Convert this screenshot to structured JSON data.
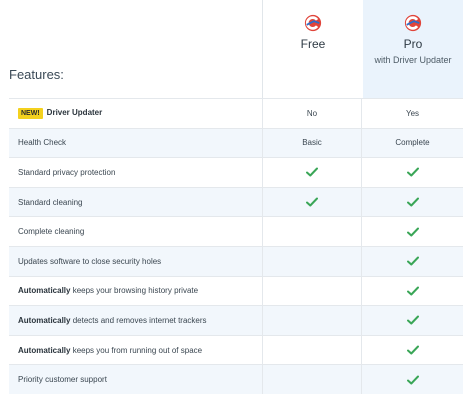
{
  "header": {
    "features_title": "Features:",
    "plans": [
      {
        "name": "Free",
        "subtitle": ""
      },
      {
        "name": "Pro",
        "subtitle": "with Driver Updater"
      }
    ],
    "logo_icon": "ccleaner-logo-icon"
  },
  "colors": {
    "check": "#3aa657",
    "badge": "#f4d11e",
    "pro_column_bg": "#eaf3fc",
    "alt_row_bg": "#f2f7fc"
  },
  "rows": [
    {
      "badge": "NEW!",
      "bold": "Driver Updater",
      "text": "",
      "free": "No",
      "pro": "Yes",
      "free_check": false,
      "pro_check": false,
      "alt": false
    },
    {
      "badge": "",
      "bold": "",
      "text": "Health Check",
      "free": "Basic",
      "pro": "Complete",
      "free_check": false,
      "pro_check": false,
      "alt": true
    },
    {
      "badge": "",
      "bold": "",
      "text": "Standard privacy protection",
      "free": "",
      "pro": "",
      "free_check": true,
      "pro_check": true,
      "alt": false
    },
    {
      "badge": "",
      "bold": "",
      "text": "Standard cleaning",
      "free": "",
      "pro": "",
      "free_check": true,
      "pro_check": true,
      "alt": true
    },
    {
      "badge": "",
      "bold": "",
      "text": "Complete cleaning",
      "free": "",
      "pro": "",
      "free_check": false,
      "pro_check": true,
      "alt": false
    },
    {
      "badge": "",
      "bold": "",
      "text": "Updates software to close security holes",
      "free": "",
      "pro": "",
      "free_check": false,
      "pro_check": true,
      "alt": true
    },
    {
      "badge": "",
      "bold": "Automatically",
      "text": " keeps your browsing history private",
      "free": "",
      "pro": "",
      "free_check": false,
      "pro_check": true,
      "alt": false
    },
    {
      "badge": "",
      "bold": "Automatically",
      "text": " detects and removes internet trackers",
      "free": "",
      "pro": "",
      "free_check": false,
      "pro_check": true,
      "alt": true
    },
    {
      "badge": "",
      "bold": "Automatically",
      "text": " keeps you from running out of space",
      "free": "",
      "pro": "",
      "free_check": false,
      "pro_check": true,
      "alt": false
    },
    {
      "badge": "",
      "bold": "",
      "text": "Priority customer support",
      "free": "",
      "pro": "",
      "free_check": false,
      "pro_check": true,
      "alt": true
    }
  ]
}
